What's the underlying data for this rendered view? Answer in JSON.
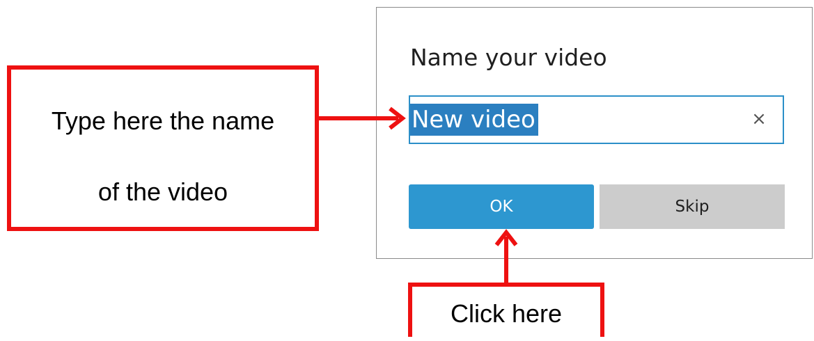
{
  "dialog": {
    "title": "Name your video",
    "name_field": {
      "value": "New video",
      "selected": true,
      "clear_icon": "close-icon"
    },
    "buttons": {
      "ok_label": "OK",
      "skip_label": "Skip"
    }
  },
  "annotations": {
    "left_callout_line1": "Type here the name",
    "left_callout_line2": "of the video",
    "bottom_callout": "Click here"
  },
  "colors": {
    "accent": "#2d97d0",
    "selection": "#2b7fc0",
    "annotation_red": "#ee1111",
    "skip_button": "#cccccc"
  }
}
